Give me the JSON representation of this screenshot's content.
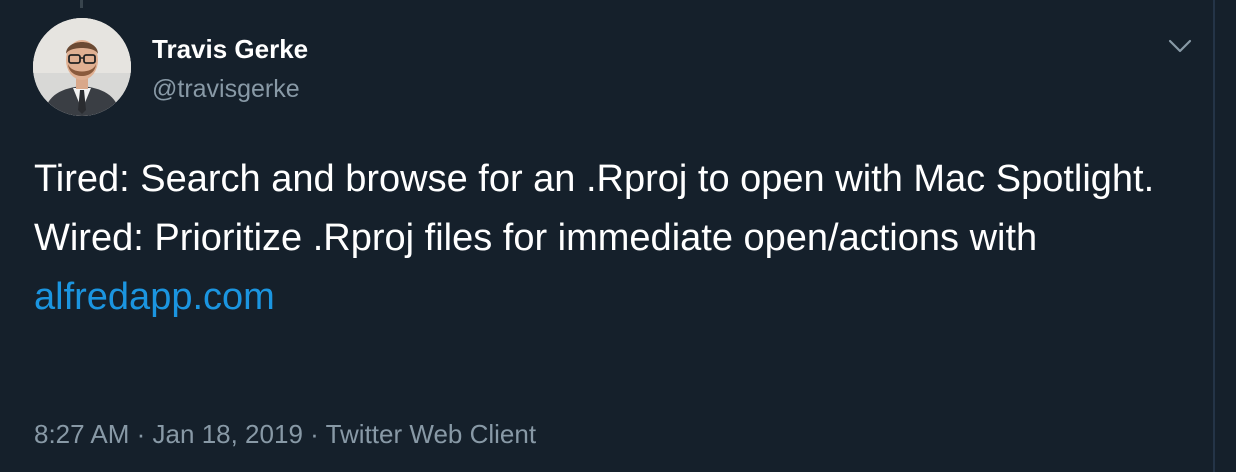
{
  "tweet": {
    "author": {
      "display_name": "Travis Gerke",
      "handle": "@travisgerke",
      "avatar_icon": "user-avatar"
    },
    "menu_icon": "chevron-down-icon",
    "lines": [
      {
        "text": "Tired: Search and browse for an .Rproj to open with Mac Spotlight."
      },
      {
        "text": "Wired: Prioritize .Rproj files for immediate open/actions with ",
        "link": "alfredapp.com"
      }
    ],
    "time": "8:27 AM",
    "date": "Jan 18, 2019",
    "separator": "·",
    "source": "Twitter Web Client"
  },
  "colors": {
    "background": "#15202b",
    "text": "#ffffff",
    "secondary": "#8899a6",
    "link": "#1b95e0"
  }
}
